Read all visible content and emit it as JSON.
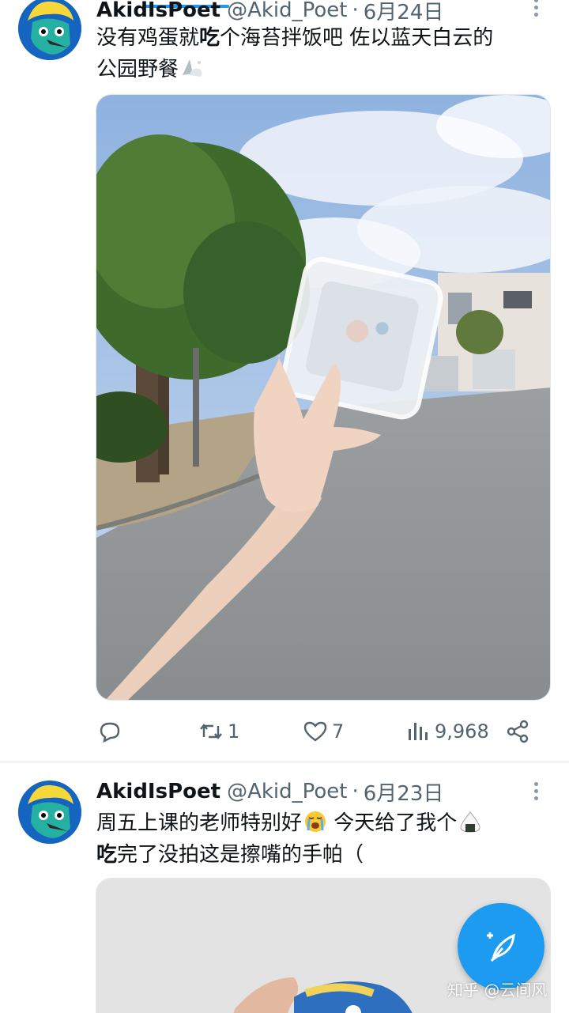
{
  "tweets": [
    {
      "author": "AkidIsPoet",
      "handle": "@Akid_Poet",
      "separator": "·",
      "date": "6月24日",
      "text_line1_a": "没有鸡蛋就",
      "text_line1_bold": "吃",
      "text_line1_b": "个海苔拌饭吧 佐以蓝天白云的",
      "text_line2": "公园野餐",
      "text_line2_emoji": "sparkle-cloud-emoji",
      "image_description": "hand holding empty plastic food container in a park under blue sky",
      "reply_count": "",
      "retweet_count": "1",
      "like_count": "7",
      "view_count": "9,968"
    },
    {
      "author": "AkidIsPoet",
      "handle": "@Akid_Poet",
      "separator": "·",
      "date": "6月23日",
      "text_line1": "周五上课的老师特别好",
      "text_line1_b": " 今天给了我个",
      "text_line2_bold": "吃",
      "text_line2_rest": "完了没拍这是擦嘴的手帕（",
      "emoji_crying": "loudly-crying-face-emoji",
      "emoji_onigiri": "rice-ball-emoji"
    }
  ],
  "icons": {
    "reply": "reply-icon",
    "retweet": "retweet-icon",
    "like": "heart-icon",
    "views": "views-bar-chart-icon",
    "share": "share-icon",
    "more": "more-dots-icon",
    "compose": "compose-feather-icon"
  },
  "colors": {
    "accent": "#1d9bf0",
    "text": "#0f1419",
    "secondary": "#536471"
  },
  "watermark": "知乎 @云间风"
}
